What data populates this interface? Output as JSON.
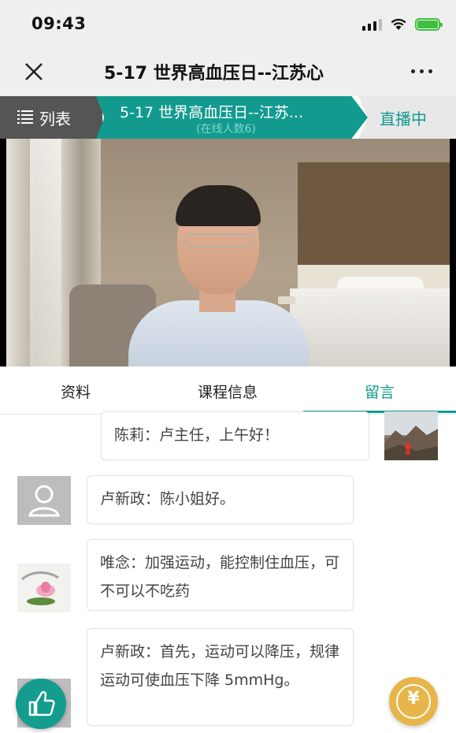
{
  "status_bar": {
    "time": "09:43"
  },
  "nav": {
    "title": "5-17 世界高血压日--江苏心"
  },
  "strip": {
    "list_label": "列表",
    "live_title": "5-17 世界高血压日--江苏...",
    "online_count": "(在线人数6)",
    "live_status": "直播中"
  },
  "tabs": [
    {
      "label": "资料"
    },
    {
      "label": "课程信息"
    },
    {
      "label": "留言"
    }
  ],
  "active_tab": "留言",
  "messages": [
    {
      "author": "陈莉",
      "text": "陈莉：卢主任，上午好！"
    },
    {
      "author": "卢新政",
      "text": "卢新政：陈小姐好。"
    },
    {
      "author": "唯念",
      "text": "唯念：加强运动，能控制住血压，可不可以不吃药"
    },
    {
      "author": "卢新政",
      "text": "卢新政：首先，运动可以降压，规律运动可使血压下降 5mmHg。"
    }
  ],
  "reward_symbol": "¥",
  "colors": {
    "accent": "#139a8f",
    "gold": "#e8b54a",
    "strip_left": "#555555"
  },
  "icons": [
    "close-icon",
    "more-icon",
    "list-icon",
    "thumbs-up-icon",
    "yuan-icon",
    "signal-icon",
    "wifi-icon",
    "battery-icon"
  ]
}
